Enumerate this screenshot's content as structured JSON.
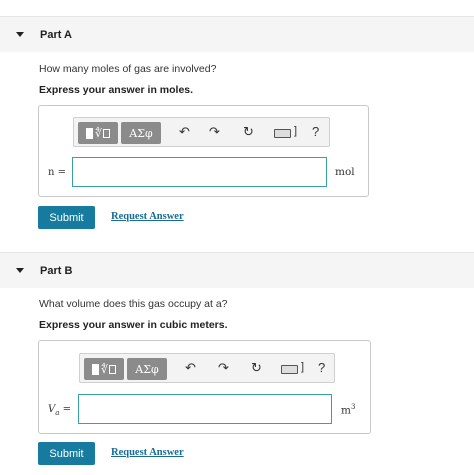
{
  "partA": {
    "title": "Part A",
    "question": "How many moles of gas are involved?",
    "instruction": "Express your answer in moles.",
    "greek_label": "ΑΣφ",
    "help_label": "?",
    "variable": "n =",
    "input_value": "",
    "unit": "mol",
    "submit_label": "Submit",
    "request_label": "Request Answer"
  },
  "partB": {
    "title": "Part B",
    "question": "What volume does this gas occupy at a?",
    "instruction": "Express your answer in cubic meters.",
    "greek_label": "ΑΣφ",
    "help_label": "?",
    "variable_main": "V",
    "variable_sub": "a",
    "variable_eq": " =",
    "input_value": "",
    "unit_base": "m",
    "unit_exp": "3",
    "submit_label": "Submit",
    "request_label": "Request Answer"
  },
  "icons": {
    "undo": "undo-icon",
    "redo": "redo-icon",
    "reset": "reset-icon",
    "keyboard": "keyboard-icon",
    "help": "help-icon"
  }
}
